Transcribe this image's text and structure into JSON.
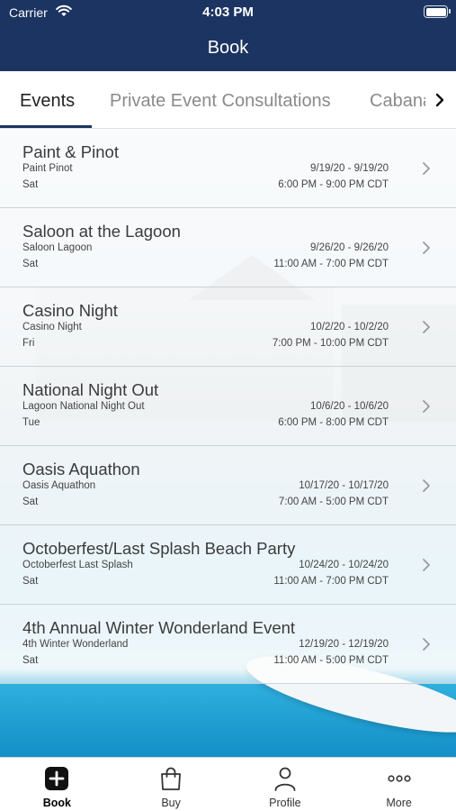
{
  "status_bar": {
    "carrier": "Carrier",
    "time": "4:03 PM"
  },
  "header": {
    "title": "Book"
  },
  "tabs": [
    {
      "label": "Events",
      "active": true
    },
    {
      "label": "Private Event Consultations",
      "active": false
    },
    {
      "label": "Cabanas",
      "active": false
    }
  ],
  "events": [
    {
      "title": "Paint & Pinot",
      "subtitle": "Paint Pinot",
      "day": "Sat",
      "dates": "9/19/20 - 9/19/20",
      "time": "6:00 PM - 9:00 PM CDT"
    },
    {
      "title": "Saloon at the Lagoon",
      "subtitle": "Saloon Lagoon",
      "day": "Sat",
      "dates": "9/26/20 - 9/26/20",
      "time": "11:00 AM - 7:00 PM CDT"
    },
    {
      "title": "Casino Night",
      "subtitle": "Casino Night",
      "day": "Fri",
      "dates": "10/2/20 - 10/2/20",
      "time": "7:00 PM - 10:00 PM CDT"
    },
    {
      "title": "National Night Out",
      "subtitle": "Lagoon National Night Out",
      "day": "Tue",
      "dates": "10/6/20 - 10/6/20",
      "time": "6:00 PM - 8:00 PM CDT"
    },
    {
      "title": "Oasis Aquathon",
      "subtitle": "Oasis Aquathon",
      "day": "Sat",
      "dates": "10/17/20 - 10/17/20",
      "time": "7:00 AM - 5:00 PM CDT"
    },
    {
      "title": "Octoberfest/Last Splash Beach Party",
      "subtitle": "Octoberfest Last Splash",
      "day": "Sat",
      "dates": "10/24/20 - 10/24/20",
      "time": "11:00 AM - 7:00 PM CDT"
    },
    {
      "title": "4th Annual Winter Wonderland Event",
      "subtitle": "4th Winter Wonderland",
      "day": "Sat",
      "dates": "12/19/20 - 12/19/20",
      "time": "11:00 AM - 5:00 PM CDT"
    }
  ],
  "tab_bar": [
    {
      "label": "Book",
      "icon": "plus-square-icon",
      "active": true
    },
    {
      "label": "Buy",
      "icon": "shopping-bag-icon",
      "active": false
    },
    {
      "label": "Profile",
      "icon": "person-icon",
      "active": false
    },
    {
      "label": "More",
      "icon": "ellipsis-icon",
      "active": false
    }
  ],
  "colors": {
    "nav_background": "#1c3461",
    "tab_underline": "#1c3461",
    "text_primary": "#3b3b3b"
  }
}
